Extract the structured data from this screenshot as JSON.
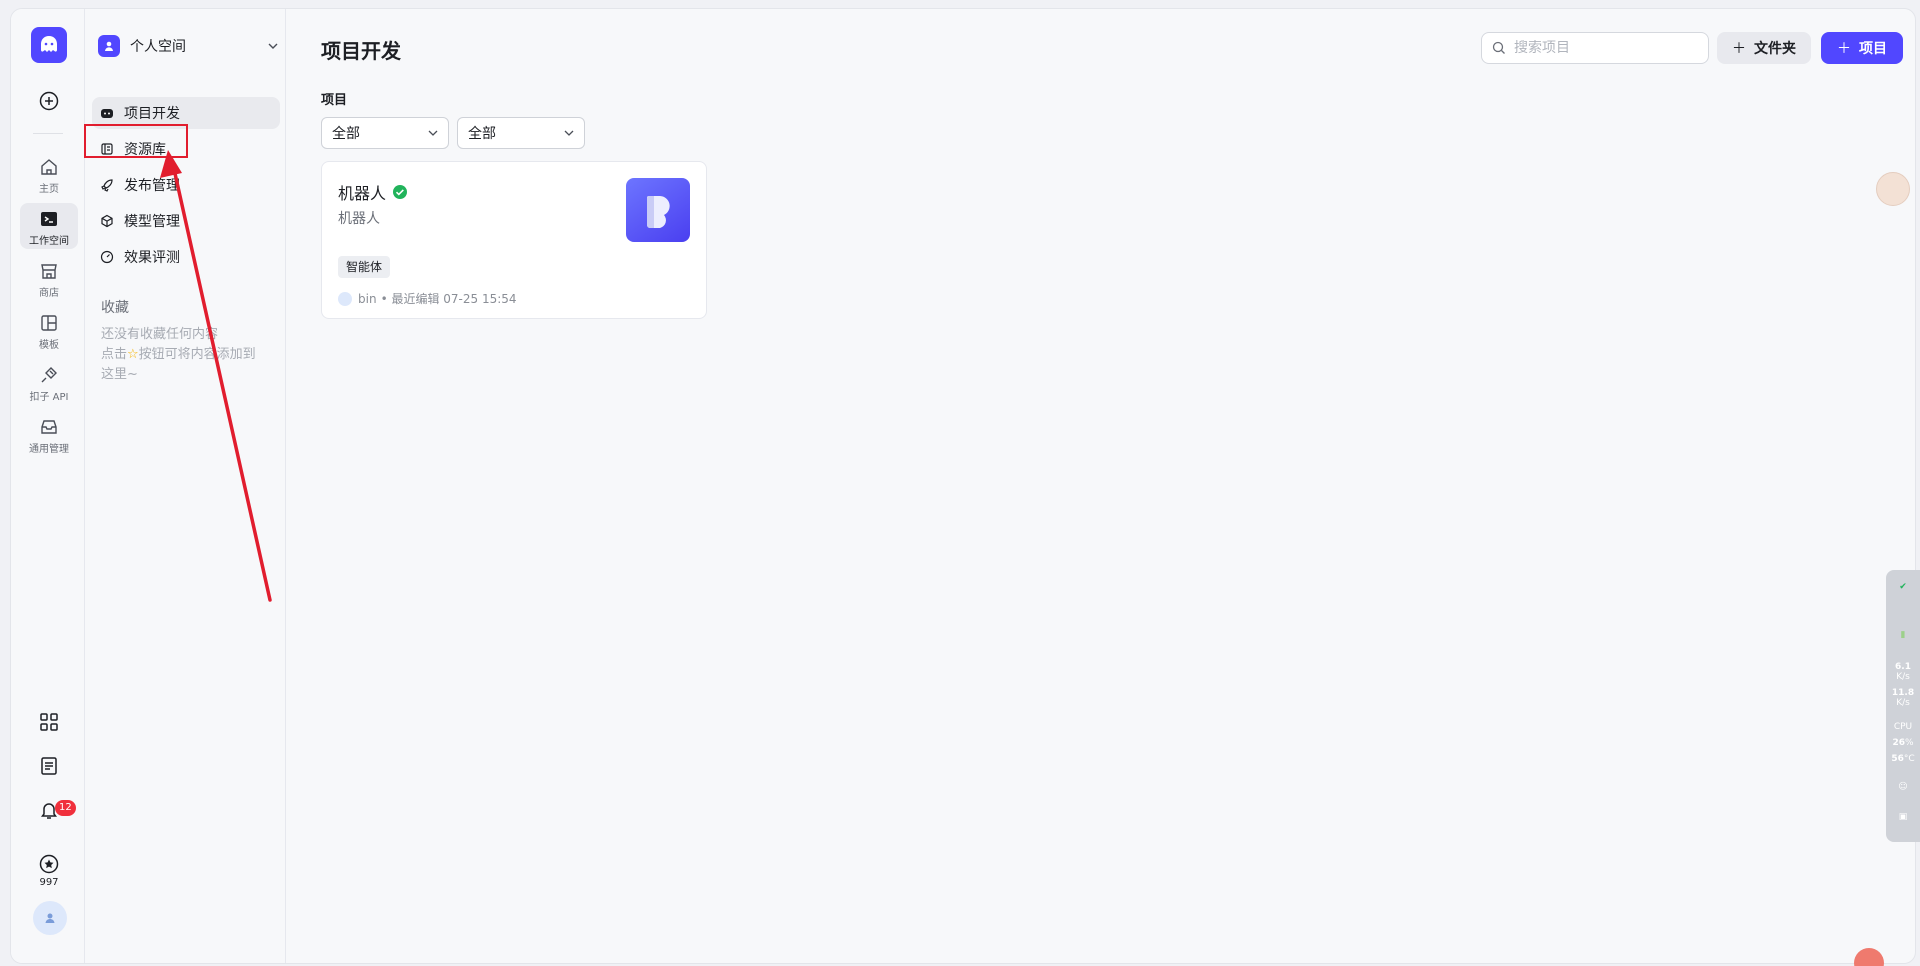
{
  "rail": {
    "items": [
      {
        "label": "主页",
        "icon": "home-icon"
      },
      {
        "label": "工作空间",
        "icon": "terminal-icon"
      },
      {
        "label": "商店",
        "icon": "store-icon"
      },
      {
        "label": "模板",
        "icon": "layout-icon"
      },
      {
        "label": "扣子 API",
        "icon": "plug-icon"
      },
      {
        "label": "通用管理",
        "icon": "inbox-icon"
      }
    ],
    "notification_count": "12",
    "score": "997"
  },
  "panel": {
    "space_name": "个人空间",
    "nav": [
      {
        "label": "项目开发"
      },
      {
        "label": "资源库"
      },
      {
        "label": "发布管理"
      },
      {
        "label": "模型管理"
      },
      {
        "label": "效果评测"
      }
    ],
    "favorites_title": "收藏",
    "favorites_empty_line1": "还没有收藏任何内容",
    "favorites_empty_line2a": "点击",
    "favorites_empty_line2b": "按钮可将内容添加到",
    "favorites_empty_line3": "这里~"
  },
  "main": {
    "title": "项目开发",
    "search_placeholder": "搜索项目",
    "folder_button": "文件夹",
    "project_button": "项目",
    "section_label": "项目",
    "filter1": "全部",
    "filter2": "全部",
    "card": {
      "name": "机器人",
      "description": "机器人",
      "tag": "智能体",
      "owner": "bin",
      "edited": "• 最近编辑 07-25 15:54"
    }
  },
  "monitor": {
    "up_speed": "6.1",
    "up_unit": "K/s",
    "down_speed": "11.8",
    "down_unit": "K/s",
    "cpu_label": "CPU",
    "cpu_value": "26",
    "cpu_unit": "%",
    "temp_value": "56",
    "temp_unit": "°C"
  },
  "colors": {
    "brand": "#5147ff",
    "highlight": "#e11d2e",
    "verified": "#21b35b"
  }
}
